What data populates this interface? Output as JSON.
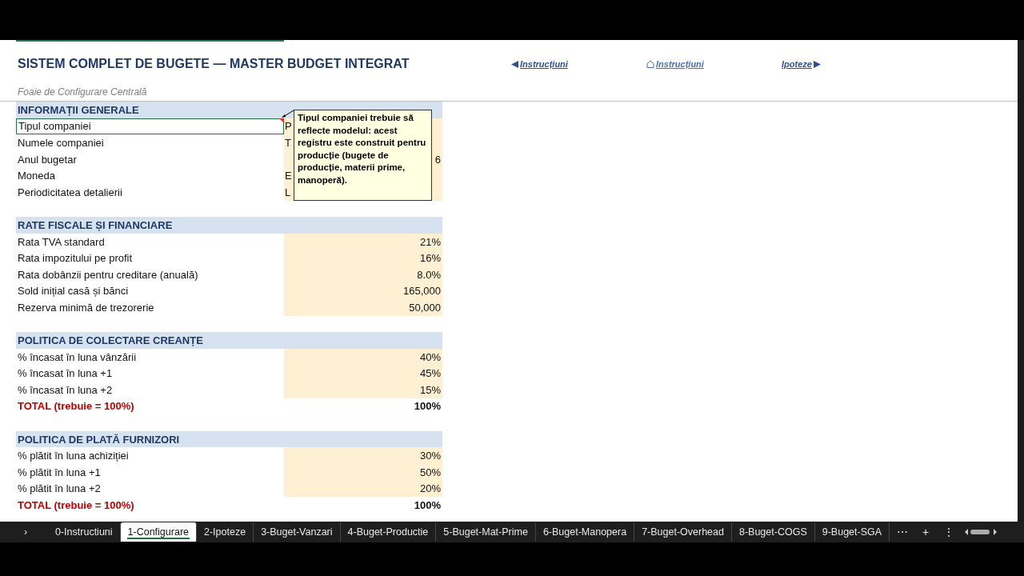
{
  "title": "SISTEM COMPLET DE BUGETE — MASTER BUDGET INTEGRAT",
  "subtitle": "Foaie de Configurare Centrală",
  "nav_links": [
    {
      "kind": "back",
      "label": "Instrucțiuni"
    },
    {
      "kind": "home",
      "label": "Instrucțiuni"
    },
    {
      "kind": "forward",
      "label": "Ipoteze"
    }
  ],
  "sections": [
    {
      "header": "INFORMAȚII GENERALE",
      "rows": [
        {
          "label": "Tipul companiei",
          "value": "P",
          "kind": "text_input",
          "selected": true,
          "comment": "Tipul companiei trebuie să reflecte modelul: acest registru este construit pentru producție (bugete de producție, materii prime, manoperă)."
        },
        {
          "label": "Numele companiei",
          "value": "T",
          "kind": "text_input",
          "selected": false
        },
        {
          "label": "Anul bugetar",
          "value": "6",
          "kind": "number_input",
          "selected": false
        },
        {
          "label": "Moneda",
          "value": "E",
          "kind": "text_input",
          "selected": false
        },
        {
          "label": "Periodicitatea detalierii",
          "value": "L",
          "kind": "text_input",
          "selected": false
        }
      ]
    },
    {
      "header": "RATE FISCALE ȘI FINANCIARE",
      "rows": [
        {
          "label": "Rata TVA standard",
          "value": "21%",
          "kind": "number_input",
          "selected": false
        },
        {
          "label": "Rata impozitului pe profit",
          "value": "16%",
          "kind": "number_input",
          "selected": false
        },
        {
          "label": "Rata dobânzii pentru creditare (anuală)",
          "value": "8.0%",
          "kind": "number_input",
          "selected": false
        },
        {
          "label": "Sold inițial casă și bănci",
          "value": "165,000",
          "kind": "number_input",
          "selected": false
        },
        {
          "label": "Rezerva minimă de trezorerie",
          "value": "50,000",
          "kind": "number_input",
          "selected": false
        }
      ]
    },
    {
      "header": "POLITICA DE COLECTARE CREANȚE",
      "rows": [
        {
          "label": "% încasat în luna vânzării",
          "value": "40%",
          "kind": "number_input",
          "selected": false
        },
        {
          "label": "% încasat în luna +1",
          "value": "45%",
          "kind": "number_input",
          "selected": false
        },
        {
          "label": "% încasat în luna +2",
          "value": "15%",
          "kind": "number_input",
          "selected": false
        },
        {
          "label": "TOTAL (trebuie = 100%)",
          "value": "100%",
          "kind": "total",
          "selected": false
        }
      ]
    },
    {
      "header": "POLITICA DE PLATĂ FURNIZORI",
      "rows": [
        {
          "label": "% plătit în luna achiziției",
          "value": "30%",
          "kind": "number_input",
          "selected": false
        },
        {
          "label": "% plătit în luna +1",
          "value": "50%",
          "kind": "number_input",
          "selected": false
        },
        {
          "label": "% plătit în luna +2",
          "value": "20%",
          "kind": "number_input",
          "selected": false
        },
        {
          "label": "TOTAL (trebuie = 100%)",
          "value": "100%",
          "kind": "total",
          "selected": false
        }
      ]
    }
  ],
  "sheet_tabs": [
    {
      "label": "0-Instructiuni",
      "selected": false
    },
    {
      "label": "1-Configurare",
      "selected": true
    },
    {
      "label": "2-Ipoteze",
      "selected": false
    },
    {
      "label": "3-Buget-Vanzari",
      "selected": false
    },
    {
      "label": "4-Buget-Productie",
      "selected": false
    },
    {
      "label": "5-Buget-Mat-Prime",
      "selected": false
    },
    {
      "label": "6-Buget-Manopera",
      "selected": false
    },
    {
      "label": "7-Buget-Overhead",
      "selected": false
    },
    {
      "label": "8-Buget-COGS",
      "selected": false
    },
    {
      "label": "9-Buget-SGA",
      "selected": false
    }
  ],
  "tab_controls": {
    "previous": "›",
    "more": "⋯",
    "add": "+",
    "options": "⋮"
  }
}
